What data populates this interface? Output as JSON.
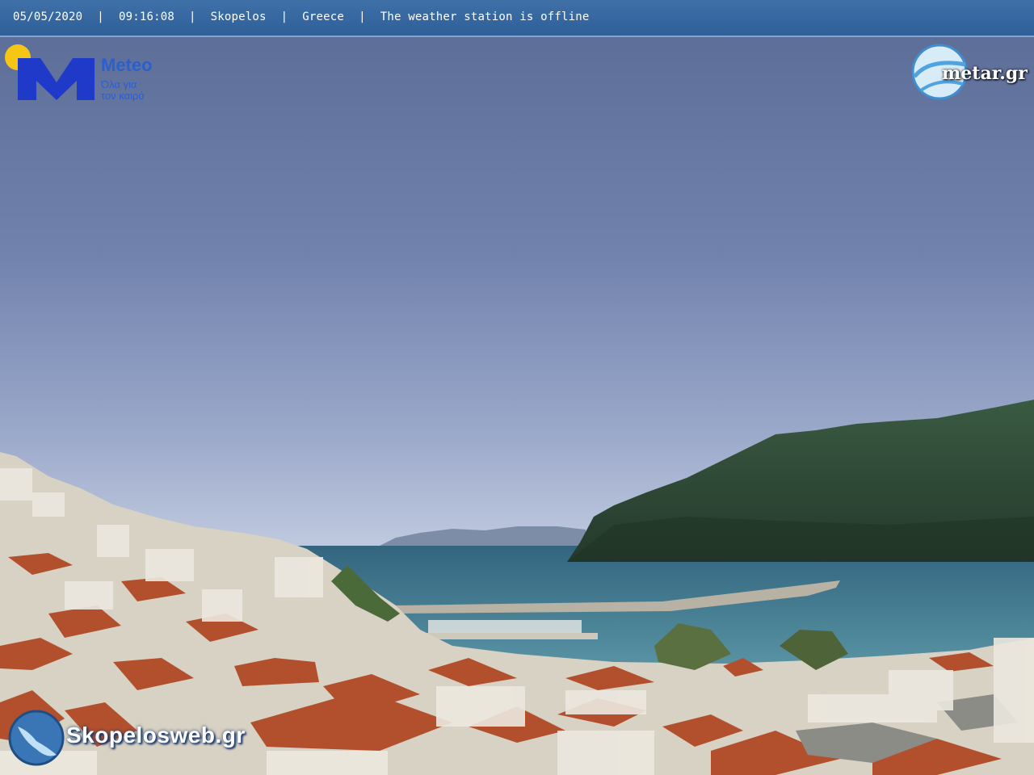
{
  "overlay": {
    "date": "05/05/2020",
    "time": "09:16:08",
    "location": "Skopelos",
    "country": "Greece",
    "status": "The weather station is offline",
    "separator": "|"
  },
  "logos": {
    "meteo_name": "Meteo",
    "meteo_tagline_1": "Όλα για",
    "meteo_tagline_2": "τον καιρό",
    "metar": "metar.gr",
    "skopelosweb": "Skopelosweb.gr"
  },
  "colors": {
    "bar": "#3a6aa4",
    "sky_top": "#5d6e98",
    "sky_bottom": "#b9c4dc",
    "sea": "#3f7a94",
    "mountain": "#2e4a35",
    "roof": "#b4502c"
  }
}
